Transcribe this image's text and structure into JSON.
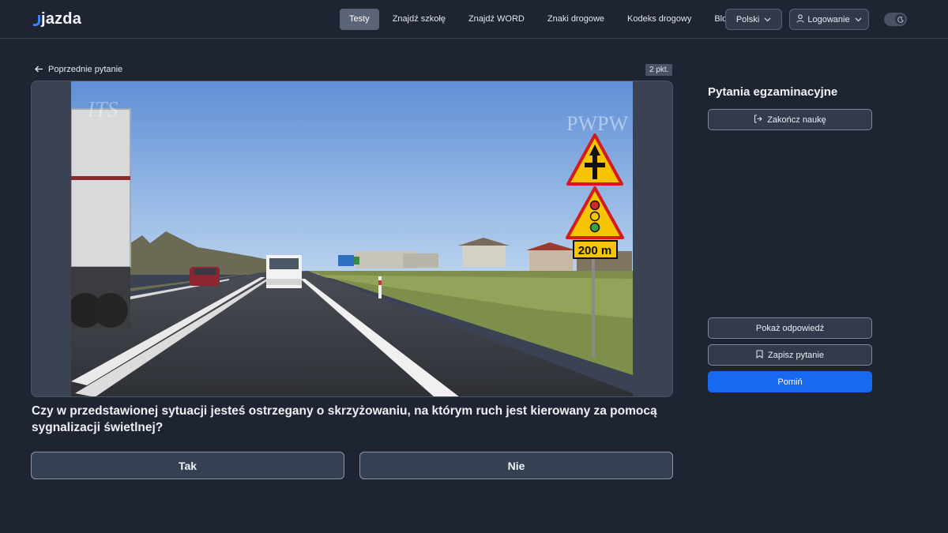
{
  "header": {
    "logo_text": "jazda",
    "nav": [
      {
        "label": "Testy",
        "active": true
      },
      {
        "label": "Znajdź szkołę",
        "active": false
      },
      {
        "label": "Znajdź WORD",
        "active": false
      },
      {
        "label": "Znaki drogowe",
        "active": false
      },
      {
        "label": "Kodeks drogowy",
        "active": false
      },
      {
        "label": "Blog",
        "active": false
      }
    ],
    "language_label": "Polski",
    "login_label": "Logowanie",
    "theme_toggle_icon": "moon-icon"
  },
  "question": {
    "back_label": "Poprzednie pytanie",
    "points_badge": "2 pkt.",
    "image_watermarks": [
      "PWPW",
      "ITS"
    ],
    "image_sign_plate": "200 m",
    "text": "Czy w przedstawionej sytuacji jesteś ostrzegany o skrzyżowaniu, na którym ruch jest kierowany za pomocą sygnalizacji świetlnej?",
    "answers": [
      "Tak",
      "Nie"
    ]
  },
  "sidebar": {
    "title": "Pytania egzaminacyjne",
    "end_study_label": "Zakończ naukę",
    "show_answer_label": "Pokaż odpowiedź",
    "save_question_label": "Zapisz pytanie",
    "skip_label": "Pomiń"
  },
  "colors": {
    "background": "#1f2433",
    "accent": "#1769ef",
    "active_nav": "#5b6477",
    "logo_accent": "#3b82f6"
  }
}
